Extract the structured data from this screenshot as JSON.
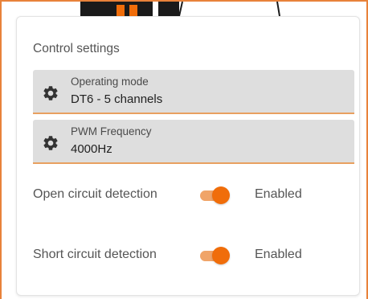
{
  "colors": {
    "accent": "#f06d0a",
    "accent_light": "#f0a468",
    "select_bg": "#dedede",
    "frame": "#e8823a"
  },
  "card": {
    "title": "Control settings"
  },
  "selects": [
    {
      "label": "Operating mode",
      "value": "DT6 - 5 channels",
      "icon": "gear-icon"
    },
    {
      "label": "PWM Frequency",
      "value": "4000Hz",
      "icon": "gear-icon"
    }
  ],
  "toggles": [
    {
      "label": "Open circuit detection",
      "state": true,
      "status": "Enabled"
    },
    {
      "label": "Short circuit detection",
      "state": true,
      "status": "Enabled"
    }
  ]
}
